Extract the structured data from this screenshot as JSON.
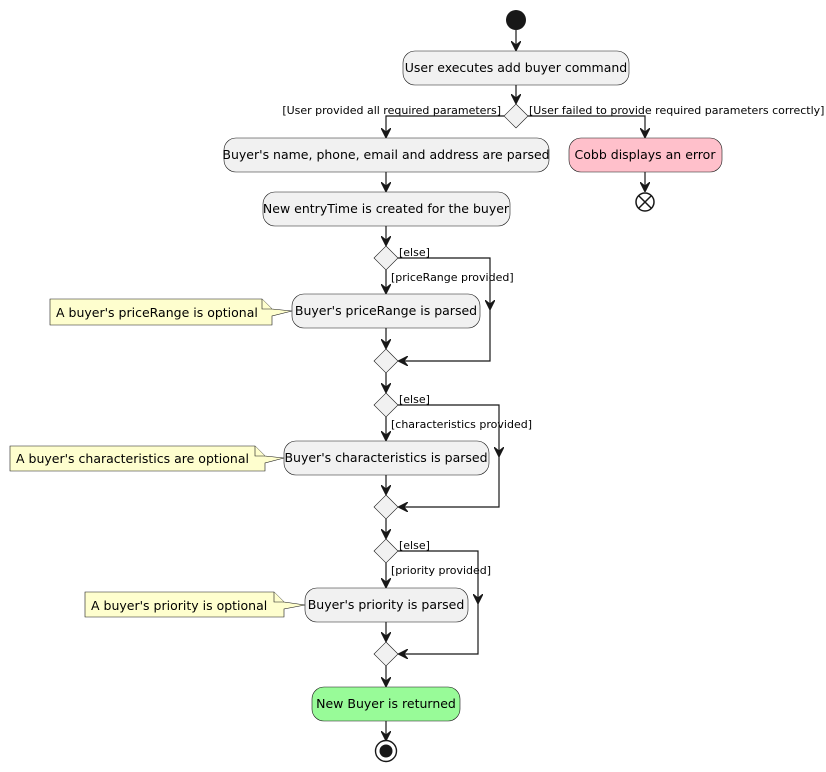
{
  "diagram": {
    "type": "activity",
    "activities": {
      "start_cmd": "User executes add buyer command",
      "parse_required": "Buyer's name, phone, email and address are parsed",
      "entry_time": "New entryTime is created for the buyer",
      "parse_price": "Buyer's priceRange is parsed",
      "parse_chars": "Buyer's characteristics is parsed",
      "parse_priority": "Buyer's priority is parsed",
      "error": "Cobb displays an error",
      "returned": "New Buyer is returned"
    },
    "guards": {
      "required_ok": "[User provided all required parameters]",
      "required_fail": "[User failed to provide required parameters correctly]",
      "else1": "[else]",
      "price_provided": "[priceRange provided]",
      "else2": "[else]",
      "chars_provided": "[characteristics provided]",
      "else3": "[else]",
      "priority_provided": "[priority provided]"
    },
    "notes": {
      "price": "A buyer's priceRange is optional",
      "chars": "A buyer's characteristics are optional",
      "priority": "A buyer's priority is optional"
    },
    "colors": {
      "activity": "#f1f1f1",
      "error": "#ffc0cb",
      "success": "#98fb98",
      "note": "#fefece",
      "line": "#181818"
    }
  }
}
